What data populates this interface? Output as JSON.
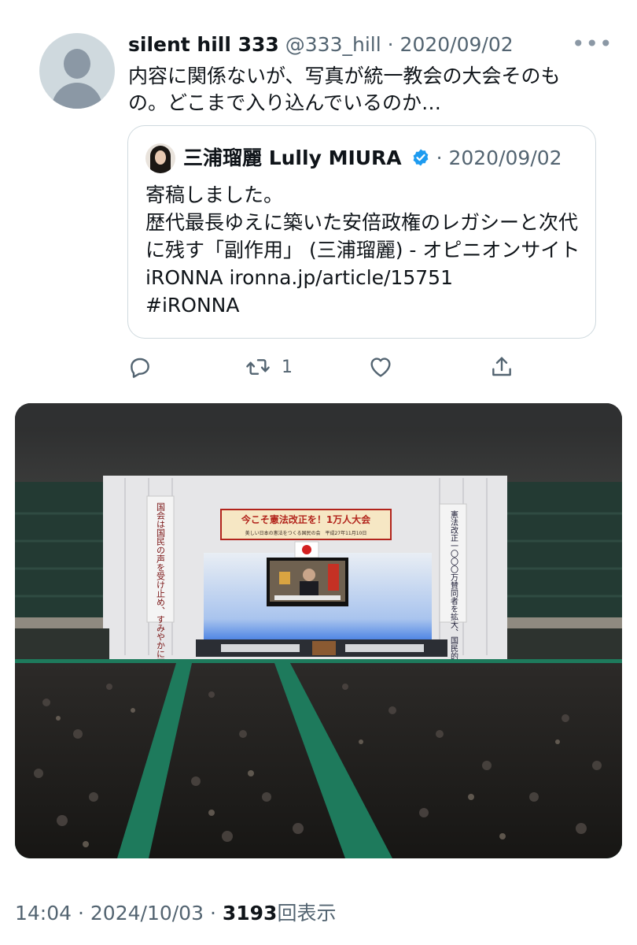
{
  "tweet": {
    "author_name": "silent hill 333",
    "handle": "@333_hill",
    "separator": "·",
    "date": "2020/09/02",
    "more_icon": "more-dots-icon",
    "text": "内容に関係ないが、写真が統一教会の大会そのもの。どこまで入り込んでいるのか…"
  },
  "quote": {
    "author_name": "三浦瑠麗 Lully MIURA",
    "verified_icon": "verified-badge-icon",
    "verified_color": "#1d9bf0",
    "separator": "·",
    "date": "2020/09/02",
    "text": "寄稿しました。\n歴代最長ゆえに築いた安倍政権のレガシーと次代に残す「副作用」 (三浦瑠麗) - オピニオンサイト iRONNA ironna.jp/article/15751\n#iRONNA"
  },
  "actions": {
    "reply_icon": "reply-icon",
    "retweet_icon": "retweet-icon",
    "retweet_count": "1",
    "like_icon": "heart-icon",
    "share_icon": "share-icon"
  },
  "photo": {
    "banner_main": "今こそ憲法改正を！1万人大会",
    "banner_sub": "美しい日本の憲法をつくる国民の会　平成27年11月10日",
    "left_banner": "国会は国民の声を受け止め、すみやかに国会発議を実現し、憲法改正の国民投票を！",
    "right_banner": "憲法改正一〇〇〇万賛同者を拡大、国民的大論議を巻き起こそう！"
  },
  "footer": {
    "time": "14:04",
    "separator1": "·",
    "date": "2024/10/03",
    "separator2": "·",
    "views_count": "3193",
    "views_label": "回表示"
  },
  "colors": {
    "text_primary": "#0f1419",
    "text_secondary": "#536471",
    "border": "#cfd9de",
    "accent": "#1d9bf0"
  }
}
